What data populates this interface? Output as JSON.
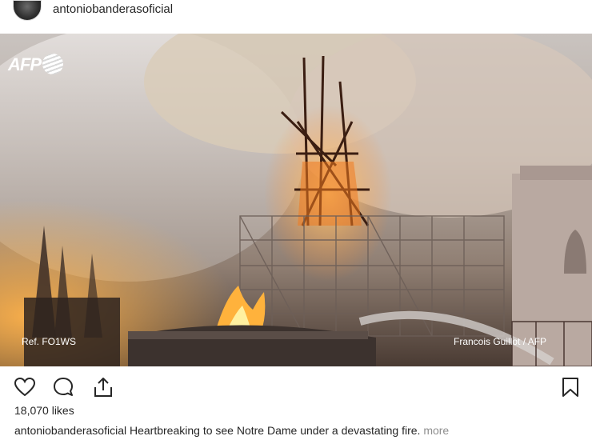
{
  "post": {
    "username": "antoniobanderasoficial",
    "photo": {
      "agency_logo_text": "AFP",
      "ref_text": "Ref. FO1WS",
      "credit_text": "Francois Guillot / AFP"
    },
    "likes_text": "18,070 likes",
    "caption": {
      "username": "antoniobanderasoficial",
      "text": "Heartbreaking to see Notre Dame under a devastating fire.",
      "more_label": "more"
    }
  },
  "icons": {
    "like": "heart-icon",
    "comment": "comment-icon",
    "share": "share-icon",
    "save": "bookmark-icon"
  }
}
